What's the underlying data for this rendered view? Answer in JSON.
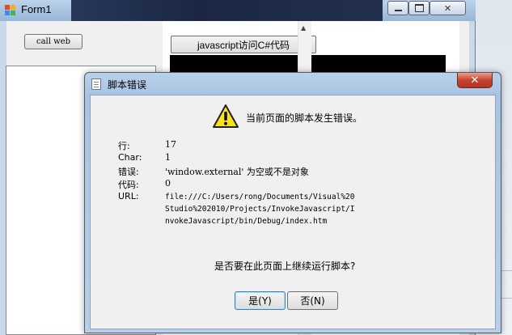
{
  "form1": {
    "title": "Form1",
    "call_web_label": "call web",
    "js_button_label": "javascript访问C#代码",
    "caption_buttons": {
      "minimize": "▭",
      "maximize": "□",
      "close": "✕"
    },
    "scroll_up_glyph": "▲"
  },
  "dialog": {
    "title": "脚本错误",
    "close_glyph": "✕",
    "message": "当前页面的脚本发生错误。",
    "fields": {
      "line_label": "行:",
      "line_value": "17",
      "char_label": "Char:",
      "char_value": "1",
      "error_label": "错误:",
      "error_value": "'window.external' 为空或不是对象",
      "code_label": "代码:",
      "code_value": "0",
      "url_label": "URL:",
      "url_value": "file:///C:/Users/rong/Documents/Visual%20Studio%202010/Projects/InvokeJavascript/InvokeJavascript/bin/Debug/index.htm"
    },
    "question": "是否要在此页面上继续运行脚本?",
    "yes_label": "是(Y)",
    "no_label": "否(N)"
  },
  "colors": {
    "accent": "#3c7fb1",
    "warning_yellow": "#f7e21b",
    "close_red": "#c7452f"
  },
  "icons": [
    "app-icon",
    "warning-icon",
    "document-icon",
    "close-icon",
    "minimize-icon",
    "maximize-icon",
    "scroll-up-icon"
  ]
}
